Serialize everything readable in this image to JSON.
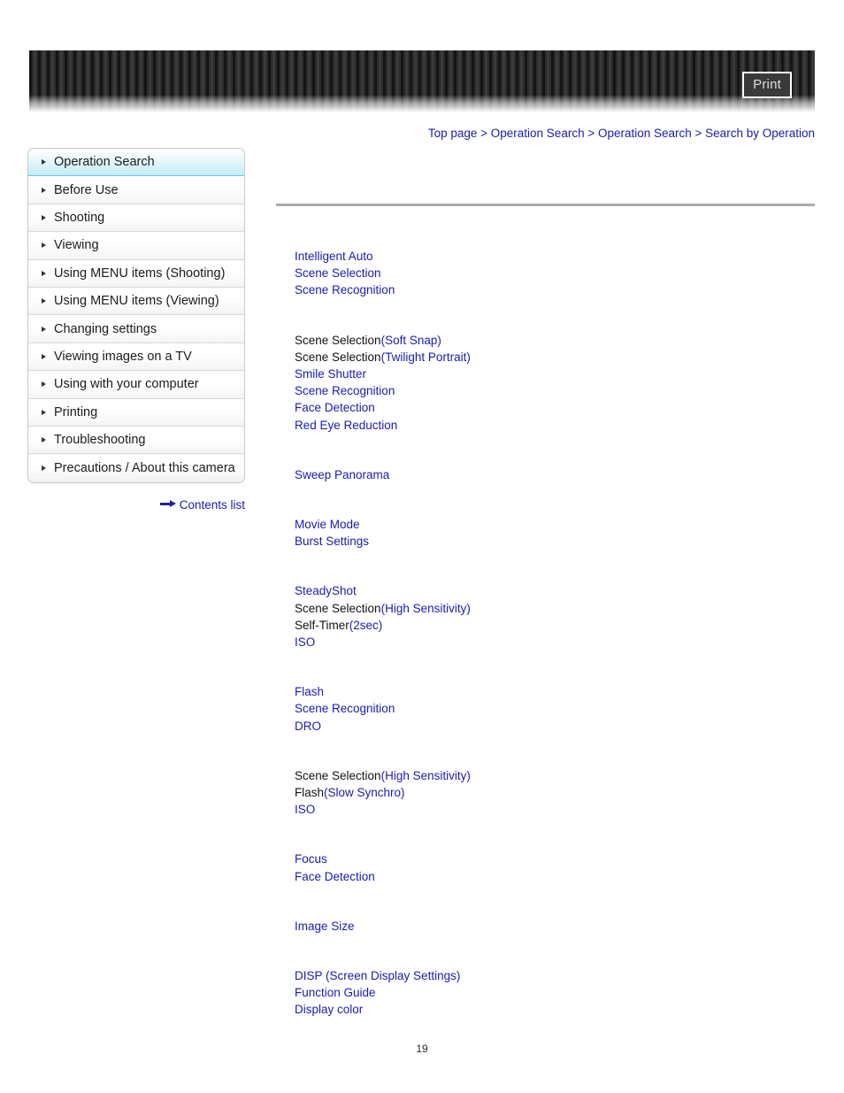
{
  "header": {
    "print_label": "Print"
  },
  "breadcrumb": {
    "separator": ">",
    "items": [
      "Top page",
      "Operation Search",
      "Operation Search",
      "Search by Operation"
    ]
  },
  "sidebar": {
    "items": [
      {
        "label": "Operation Search",
        "active": true
      },
      {
        "label": "Before Use",
        "active": false
      },
      {
        "label": "Shooting",
        "active": false
      },
      {
        "label": "Viewing",
        "active": false
      },
      {
        "label": "Using MENU items (Shooting)",
        "active": false
      },
      {
        "label": "Using MENU items (Viewing)",
        "active": false
      },
      {
        "label": "Changing settings",
        "active": false
      },
      {
        "label": "Viewing images on a TV",
        "active": false
      },
      {
        "label": "Using with your computer",
        "active": false
      },
      {
        "label": "Printing",
        "active": false
      },
      {
        "label": "Troubleshooting",
        "active": false
      },
      {
        "label": "Precautions / About this camera",
        "active": false
      }
    ],
    "contents_list_label": "Contents list"
  },
  "main": {
    "groups": [
      {
        "rows": [
          {
            "lead": "",
            "tail": "Intelligent Auto"
          },
          {
            "lead": "",
            "tail": "Scene Selection"
          },
          {
            "lead": "",
            "tail": "Scene Recognition"
          }
        ]
      },
      {
        "rows": [
          {
            "lead": "Scene Selection",
            "tail": "(Soft Snap)"
          },
          {
            "lead": "Scene Selection",
            "tail": "(Twilight Portrait)"
          },
          {
            "lead": "",
            "tail": "Smile Shutter"
          },
          {
            "lead": "",
            "tail": "Scene Recognition"
          },
          {
            "lead": "",
            "tail": "Face Detection"
          },
          {
            "lead": "",
            "tail": "Red Eye Reduction"
          }
        ]
      },
      {
        "rows": [
          {
            "lead": "",
            "tail": "Sweep Panorama"
          }
        ]
      },
      {
        "rows": [
          {
            "lead": "",
            "tail": "Movie Mode"
          },
          {
            "lead": "",
            "tail": "Burst Settings"
          }
        ]
      },
      {
        "rows": [
          {
            "lead": "",
            "tail": "SteadyShot"
          },
          {
            "lead": "Scene Selection",
            "tail": "(High Sensitivity)"
          },
          {
            "lead": "Self-Timer",
            "tail": "(2sec)"
          },
          {
            "lead": "",
            "tail": "ISO"
          }
        ]
      },
      {
        "rows": [
          {
            "lead": "",
            "tail": "Flash"
          },
          {
            "lead": "",
            "tail": "Scene Recognition"
          },
          {
            "lead": "",
            "tail": "DRO"
          }
        ]
      },
      {
        "rows": [
          {
            "lead": "Scene Selection",
            "tail": "(High Sensitivity)"
          },
          {
            "lead": "Flash",
            "tail": "(Slow Synchro)"
          },
          {
            "lead": "",
            "tail": "ISO"
          }
        ]
      },
      {
        "rows": [
          {
            "lead": "",
            "tail": "Focus"
          },
          {
            "lead": "",
            "tail": "Face Detection"
          }
        ]
      },
      {
        "rows": [
          {
            "lead": "",
            "tail": "Image Size"
          }
        ]
      },
      {
        "rows": [
          {
            "lead": "",
            "tail": "DISP (Screen Display Settings)"
          },
          {
            "lead": "",
            "tail": "Function Guide"
          },
          {
            "lead": "",
            "tail": "Display color"
          }
        ]
      }
    ]
  },
  "footer": {
    "page_number": "19"
  },
  "colors": {
    "link": "#1a1ab4",
    "text": "#111111",
    "active_nav": "#bdecf7",
    "rule": "#ababab"
  }
}
